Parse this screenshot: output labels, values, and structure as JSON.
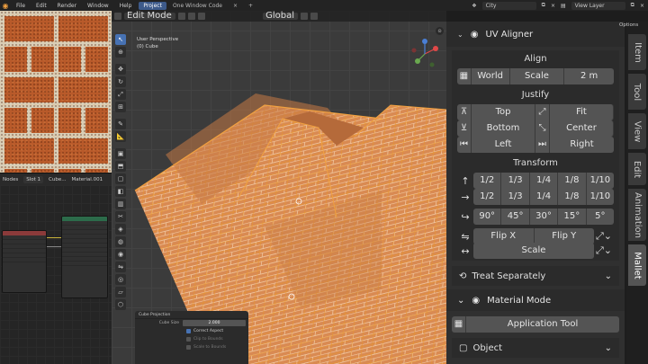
{
  "menu": {
    "items": [
      "File",
      "Edit",
      "Render",
      "Window",
      "Help"
    ]
  },
  "workspaces": [
    "Project",
    "One Window Code"
  ],
  "top_right": {
    "scene": "City",
    "view_layer": "View Layer"
  },
  "node_editor": {
    "header": {
      "type": "Nodes",
      "slot": "Slot 1",
      "object": "Cube...",
      "material": "Material.001"
    }
  },
  "viewport": {
    "mode": "Edit Mode",
    "orientation": "Global",
    "options_label": "Options",
    "view_name": "User Perspective",
    "object_name": "(0) Cube"
  },
  "operator_panel": {
    "title": "Cube Projection",
    "cube_size_label": "Cube Size",
    "cube_size_value": "2.000",
    "correct_aspect": "Correct Aspect",
    "clip_to_bounds": "Clip to Bounds",
    "scale_to_bounds": "Scale to Bounds"
  },
  "uv_aligner": {
    "title": "UV Aligner",
    "align": {
      "title": "Align",
      "world": "World",
      "scale": "Scale",
      "size": "2 m"
    },
    "justify": {
      "title": "Justify",
      "top": "Top",
      "fit": "Fit",
      "bottom": "Bottom",
      "center": "Center",
      "left": "Left",
      "right": "Right"
    },
    "transform": {
      "title": "Transform",
      "fractions_a": [
        "1/2",
        "1/3",
        "1/4",
        "1/8",
        "1/10"
      ],
      "fractions_b": [
        "1/2",
        "1/3",
        "1/4",
        "1/8",
        "1/10"
      ],
      "angles": [
        "90°",
        "45°",
        "30°",
        "15°",
        "5°"
      ],
      "flip_x": "Flip X",
      "flip_y": "Flip Y",
      "scale": "Scale"
    },
    "treat": "Treat Separately",
    "material_mode": {
      "title": "Material Mode",
      "application_tool": "Application Tool",
      "object": "Object"
    }
  },
  "tabs": [
    "Item",
    "Tool",
    "View",
    "Edit",
    "Animation",
    "Mallet"
  ],
  "colors": {
    "accent": "#4772b3",
    "button": "#545454",
    "panel": "#303030",
    "mesh_edge": "#e8962e"
  }
}
